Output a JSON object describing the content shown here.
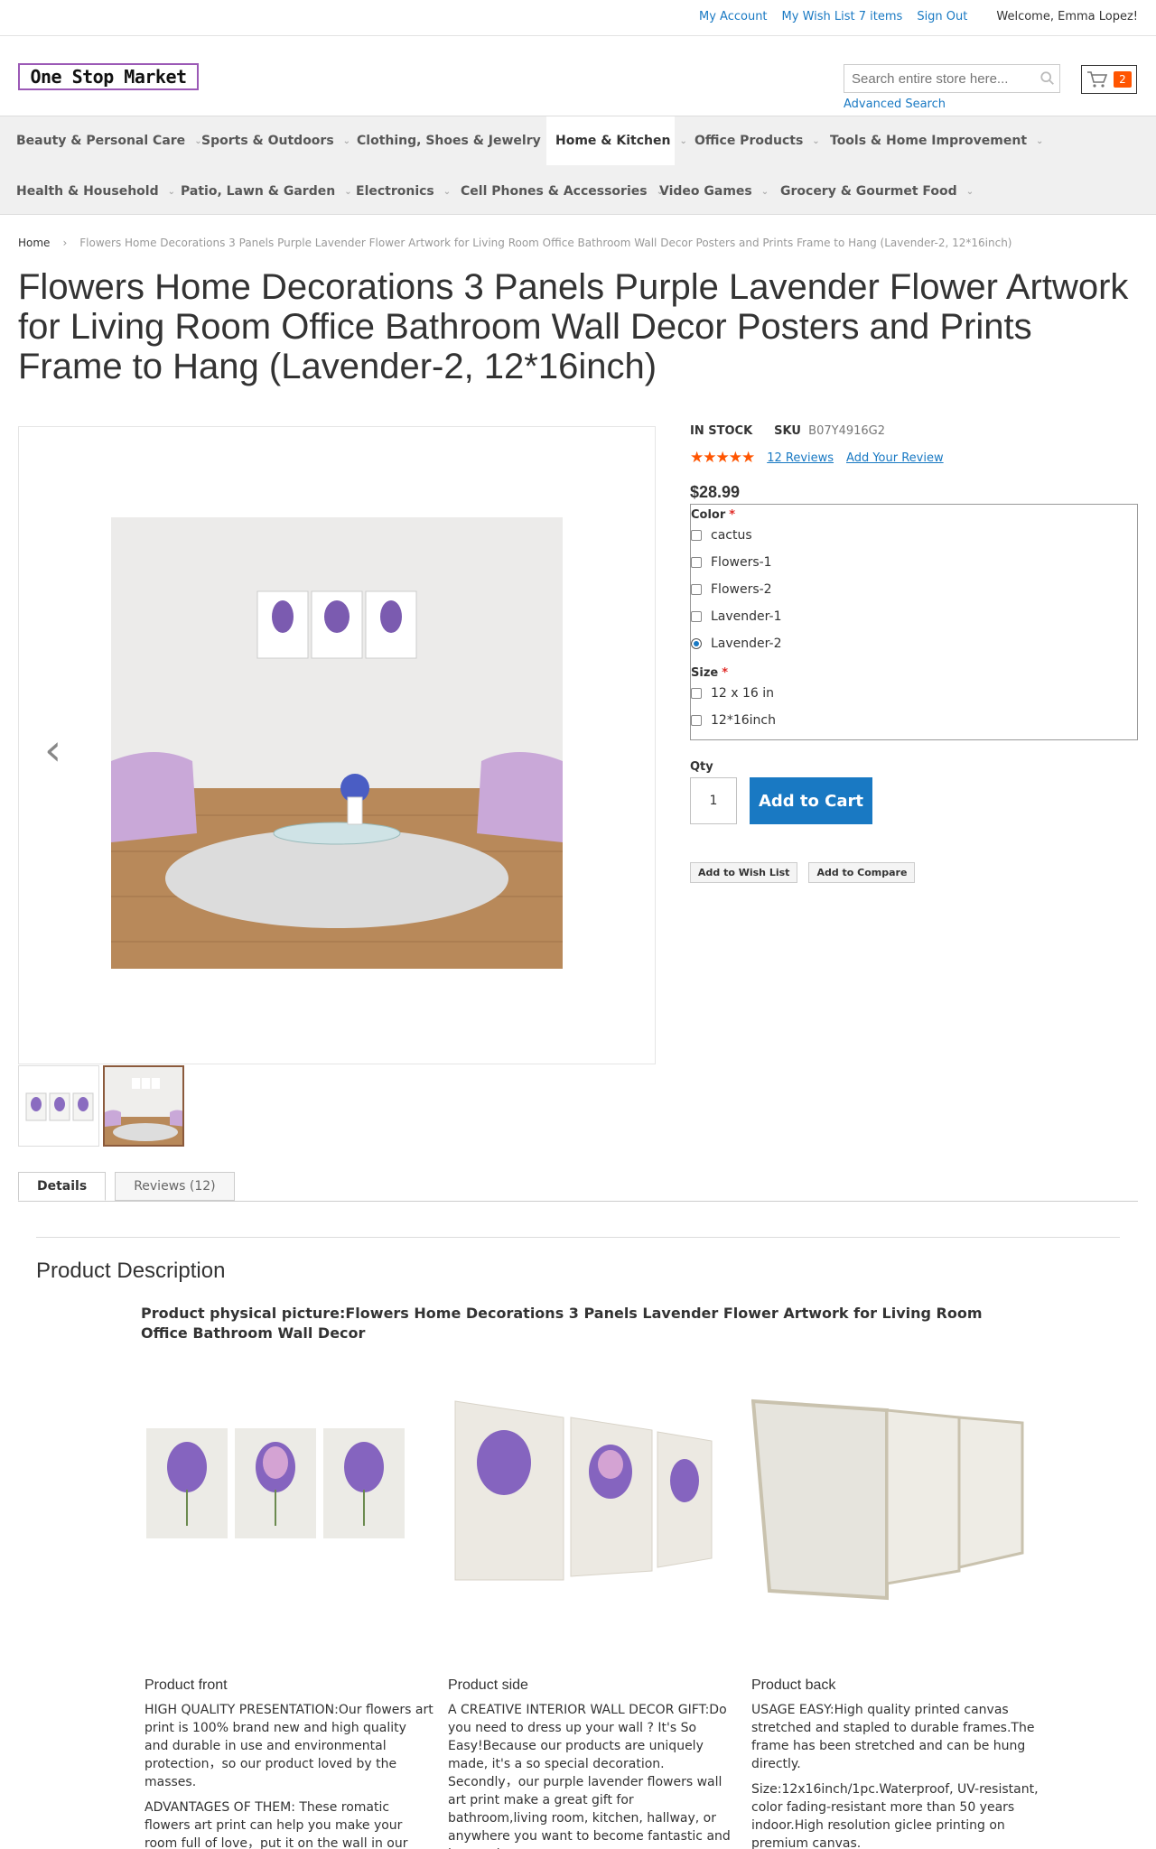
{
  "header": {
    "links": {
      "my_account": "My Account",
      "wish_list": "My Wish List 7 items",
      "sign_out": "Sign Out"
    },
    "welcome": "Welcome, Emma Lopez!",
    "logo_text": "One Stop Market",
    "search_placeholder": "Search entire store here...",
    "advanced_search": "Advanced Search",
    "cart_count": "2"
  },
  "nav": {
    "row1": [
      "Beauty & Personal Care",
      "Sports & Outdoors",
      "Clothing, Shoes & Jewelry",
      "Home & Kitchen",
      "Office Products",
      "Tools & Home Improvement"
    ],
    "row2": [
      "Health & Household",
      "Patio, Lawn & Garden",
      "Electronics",
      "Cell Phones & Accessories",
      "Video Games",
      "Grocery & Gourmet Food"
    ]
  },
  "breadcrumb": {
    "home": "Home",
    "current": "Flowers Home Decorations 3 Panels Purple Lavender Flower Artwork for Living Room Office Bathroom Wall Decor Posters and Prints Frame to Hang (Lavender-2, 12*16inch)"
  },
  "product": {
    "title": "Flowers Home Decorations 3 Panels Purple Lavender Flower Artwork for Living Room Office Bathroom Wall Decor Posters and Prints Frame to Hang (Lavender-2, 12*16inch)",
    "stock": "IN STOCK",
    "sku_label": "SKU",
    "sku": "B07Y4916G2",
    "rating_stars": "★★★★★",
    "rating_fraction": 0.9,
    "reviews_link": "12  Reviews",
    "add_review": "Add Your Review",
    "price": "$28.99",
    "color_label": "Color",
    "colors": [
      "cactus",
      "Flowers-1",
      "Flowers-2",
      "Lavender-1",
      "Lavender-2"
    ],
    "selected_color": "Lavender-2",
    "size_label": "Size",
    "sizes": [
      "12 x 16 in",
      "12*16inch"
    ],
    "qty_label": "Qty",
    "qty": "1",
    "add_to_cart": "Add to Cart",
    "add_to_wish": "Add to Wish List",
    "add_to_compare": "Add to Compare",
    "required_mark": "*"
  },
  "tabs": {
    "details": "Details",
    "reviews": "Reviews (12)"
  },
  "description": {
    "heading": "Product Description",
    "subheading": "Product physical picture:Flowers Home Decorations 3 Panels Lavender Flower Artwork for Living Room Office Bathroom Wall Decor",
    "columns": [
      {
        "title": "Product front",
        "p1": "HIGH QUALITY PRESENTATION:Our flowers art print is 100% brand new and high quality and durable in use and environmental protection，so our product loved by the masses.",
        "p2": "ADVANTAGES OF THEM: These romatic flowers art print can help you make your room full of love，put it on the wall in our room and you can add love to the bathroom"
      },
      {
        "title": "Product side",
        "p1": "A CREATIVE INTERIOR WALL DECOR GIFT:Do you need to dress up your wall ? It's So Easy!Because our products are uniquely made, it's a so special decoration. Secondly，our purple lavender flowers wall art print make a great gift for bathroom,living room, kitchen, hallway, or anywhere you want to become fantastic and interesting .",
        "p2": ""
      },
      {
        "title": "Product back",
        "p1": "USAGE EASY:High quality printed canvas stretched and stapled to durable frames.The frame has been stretched and can be hung directly.",
        "p2": "Size:12x16inch/1pc.Waterproof, UV-resistant, color fading-resistant more than 50 years indoor.High resolution giclee printing on premium canvas."
      }
    ]
  },
  "colors": {
    "link": "#1979c3",
    "accent": "#ff5501",
    "button": "#1979c3"
  }
}
